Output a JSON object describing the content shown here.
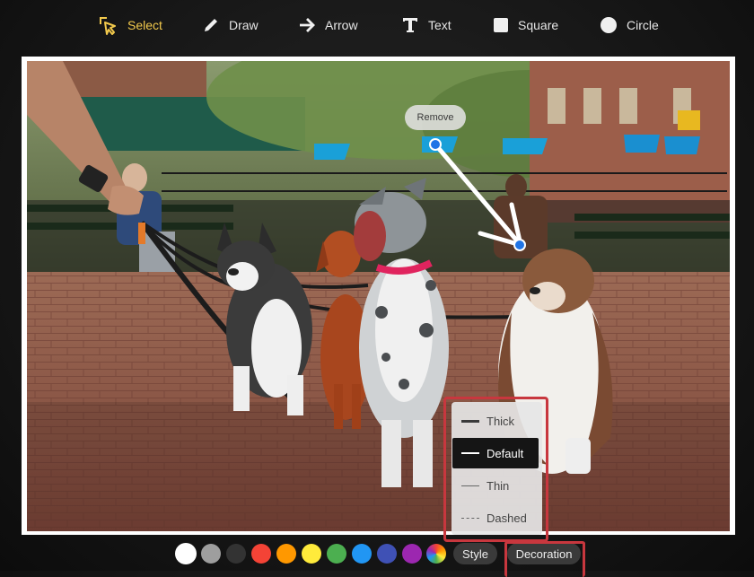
{
  "toolbar": {
    "tools": [
      {
        "label": "Select",
        "icon": "cursor-select-icon",
        "active": true
      },
      {
        "label": "Draw",
        "icon": "pencil-icon"
      },
      {
        "label": "Arrow",
        "icon": "arrow-right-icon"
      },
      {
        "label": "Text",
        "icon": "text-t-icon"
      },
      {
        "label": "Square",
        "icon": "square-icon"
      },
      {
        "label": "Circle",
        "icon": "circle-icon"
      }
    ]
  },
  "annotation": {
    "remove_label": "Remove"
  },
  "style_menu": {
    "options": [
      {
        "label": "Thick"
      },
      {
        "label": "Default",
        "selected": true
      },
      {
        "label": "Thin"
      },
      {
        "label": "Dashed"
      }
    ]
  },
  "bottom_bar": {
    "colors": [
      "#ffffff",
      "#9e9e9e",
      "#333333",
      "#f44336",
      "#ff9800",
      "#ffeb3b",
      "#4caf50",
      "#2196f3",
      "#3f51b5",
      "#9c27b0"
    ],
    "style_label": "Style",
    "decoration_label": "Decoration"
  }
}
